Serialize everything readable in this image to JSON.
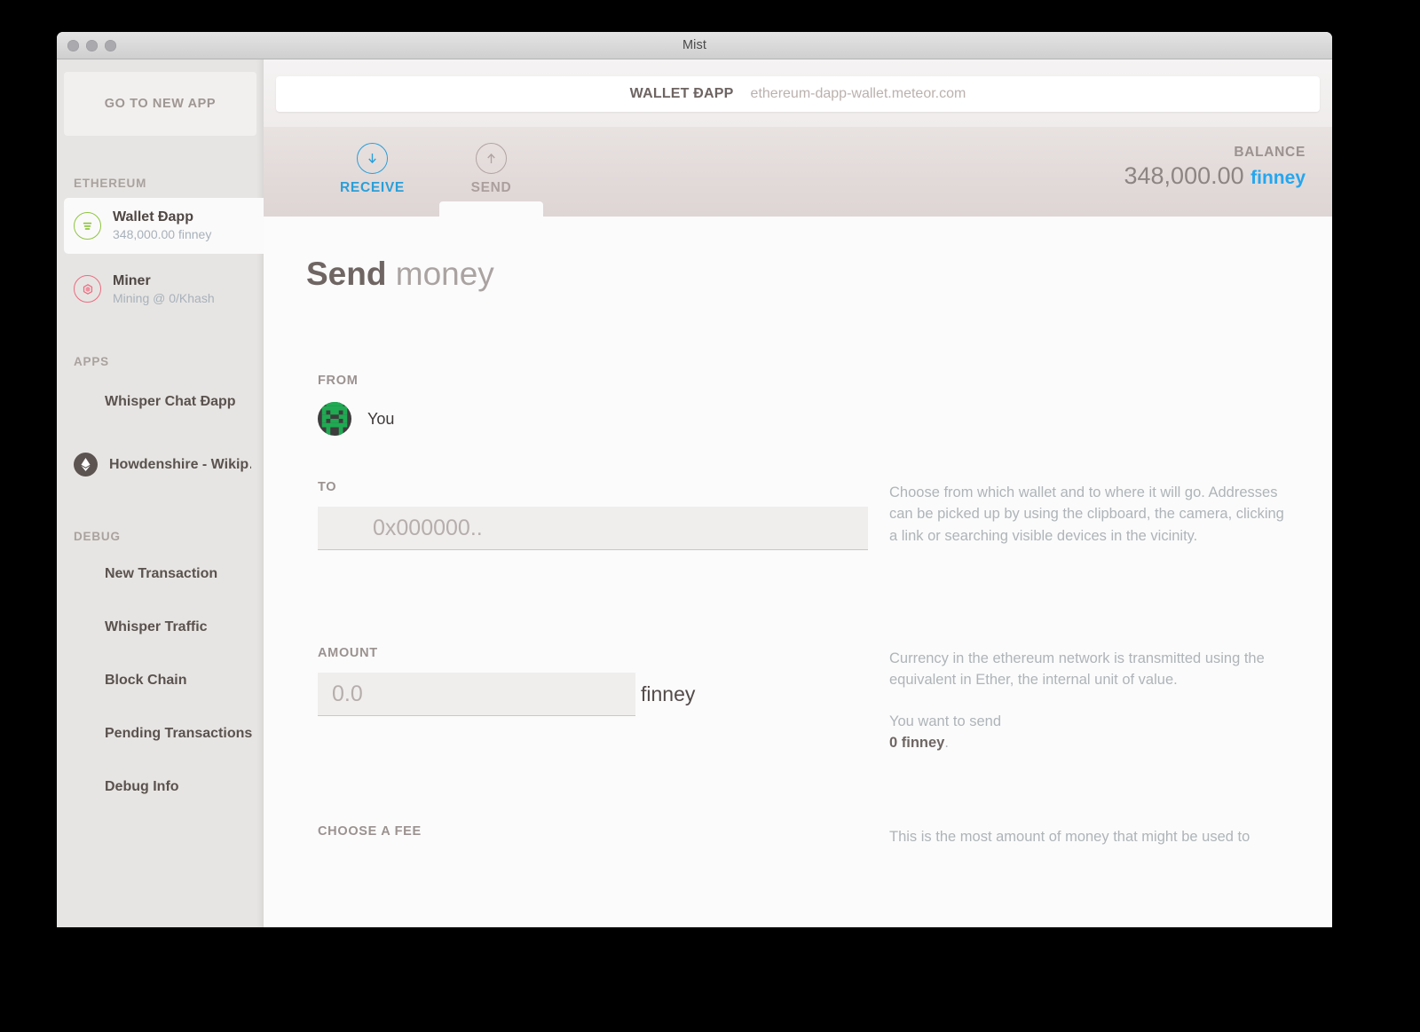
{
  "window": {
    "title": "Mist",
    "traffic_lights": [
      "close-button",
      "minimize-button",
      "maximize-button"
    ]
  },
  "sidebar": {
    "new_app_button": "GO TO NEW APP",
    "sections": {
      "ethereum": "ETHEREUM",
      "apps": "APPS",
      "debug": "DEBUG"
    },
    "wallets": [
      {
        "name": "Wallet Đapp",
        "sub": "348,000.00 finney",
        "icon": "wallet-icon",
        "accent": "#8dc63f",
        "active": true
      },
      {
        "name": "Miner",
        "sub": "Mining @ 0/Khash",
        "icon": "miner-icon",
        "accent": "#e96c80",
        "active": false
      }
    ],
    "apps": [
      {
        "label": "Whisper Chat Đapp",
        "icon": null
      },
      {
        "label": "Howdenshire - Wikip…",
        "icon": "ethereum-favicon"
      }
    ],
    "debug_items": [
      "New Transaction",
      "Whisper Traffic",
      "Block Chain",
      "Pending Transactions",
      "Debug Info"
    ]
  },
  "urlbar": {
    "dapp_name": "WALLET ĐAPP",
    "url": "ethereum-dapp-wallet.meteor.com"
  },
  "tabs": [
    {
      "label": "RECEIVE",
      "icon": "arrow-down-circle-icon",
      "color": "#2a9fd8",
      "active": false
    },
    {
      "label": "SEND",
      "icon": "arrow-up-circle-icon",
      "color": "#ab9f9d",
      "active": true
    }
  ],
  "balance": {
    "label": "BALANCE",
    "value": "348,000.00",
    "unit": "finney",
    "unit_color": "#25a6ef"
  },
  "page": {
    "title_bold": "Send",
    "title_light": "money"
  },
  "form": {
    "from": {
      "label": "FROM",
      "account_name": "You",
      "avatar": "blockie-identicon"
    },
    "to": {
      "label": "TO",
      "value": "",
      "placeholder": "0x000000..",
      "help": "Choose from which wallet and to where it will go. Addresses can be picked up by using the clipboard, the camera, clicking a link or searching visible devices in the vicinity."
    },
    "amount": {
      "label": "AMOUNT",
      "value": "",
      "placeholder": "0.0",
      "unit": "finney",
      "help": "Currency in the ethereum network is transmitted using the equivalent in Ether, the internal unit of value.",
      "summary_prefix": "You want to send",
      "summary_value": "0 finney",
      "summary_suffix": "."
    },
    "fee": {
      "label": "CHOOSE A FEE",
      "help": "This is the most amount of money that might be used to"
    }
  }
}
